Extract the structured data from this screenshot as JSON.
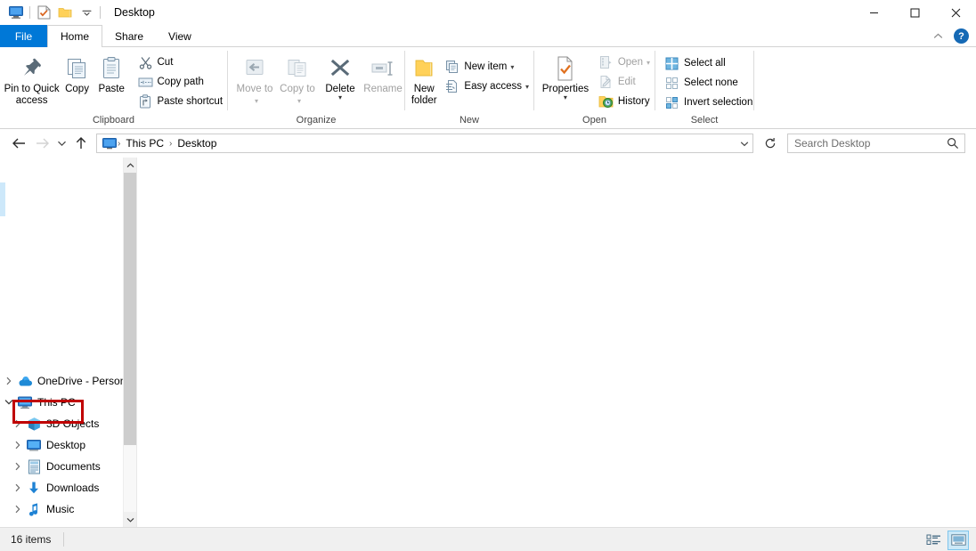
{
  "window": {
    "title": "Desktop",
    "quick_access": [
      {
        "name": "this-pc-icon",
        "label": "This PC"
      },
      {
        "name": "properties-check-icon",
        "label": "Properties"
      },
      {
        "name": "new-folder-icon",
        "label": "New folder"
      },
      {
        "name": "customize-qat-chevron-icon",
        "label": "Customize Quick Access Toolbar"
      }
    ],
    "controls": {
      "minimize": "—",
      "maximize": "□",
      "close": "✕",
      "collapse_ribbon": "⌃",
      "help": "?"
    }
  },
  "tabs": [
    {
      "label": "File",
      "active": false,
      "style": "file"
    },
    {
      "label": "Home",
      "active": true,
      "style": "normal"
    },
    {
      "label": "Share",
      "active": false,
      "style": "normal"
    },
    {
      "label": "View",
      "active": false,
      "style": "normal"
    }
  ],
  "ribbon": {
    "groups": [
      {
        "label": "Clipboard",
        "big_buttons": [
          {
            "label": "Pin to Quick access",
            "icon": "pin-icon",
            "disabled": false
          },
          {
            "label": "Copy",
            "icon": "copy-icon",
            "disabled": false
          },
          {
            "label": "Paste",
            "icon": "paste-icon",
            "disabled": false
          }
        ],
        "small_buttons": [
          {
            "label": "Cut",
            "icon": "scissors-icon",
            "disabled": false,
            "caret": false
          },
          {
            "label": "Copy path",
            "icon": "copy-path-icon",
            "disabled": false,
            "caret": false
          },
          {
            "label": "Paste shortcut",
            "icon": "paste-shortcut-icon",
            "disabled": false,
            "caret": false
          }
        ]
      },
      {
        "label": "Organize",
        "big_buttons": [
          {
            "label": "Move to",
            "icon": "move-to-icon",
            "disabled": true,
            "caret": true
          },
          {
            "label": "Copy to",
            "icon": "copy-to-icon",
            "disabled": true,
            "caret": true
          },
          {
            "label": "Delete",
            "icon": "delete-x-icon",
            "disabled": false,
            "caret": true
          },
          {
            "label": "Rename",
            "icon": "rename-icon",
            "disabled": true,
            "caret": false
          }
        ],
        "small_buttons": []
      },
      {
        "label": "New",
        "big_buttons": [
          {
            "label": "New folder",
            "icon": "new-folder-icon",
            "disabled": false
          }
        ],
        "small_buttons": [
          {
            "label": "New item",
            "icon": "new-item-icon",
            "disabled": false,
            "caret": true
          },
          {
            "label": "Easy access",
            "icon": "easy-access-icon",
            "disabled": false,
            "caret": true
          }
        ]
      },
      {
        "label": "Open",
        "big_buttons": [
          {
            "label": "Properties",
            "icon": "properties-icon",
            "disabled": false,
            "caret": true
          }
        ],
        "small_buttons": [
          {
            "label": "Open",
            "icon": "open-icon",
            "disabled": true,
            "caret": true
          },
          {
            "label": "Edit",
            "icon": "edit-icon",
            "disabled": true,
            "caret": false
          },
          {
            "label": "History",
            "icon": "history-icon",
            "disabled": false,
            "caret": false
          }
        ]
      },
      {
        "label": "Select",
        "big_buttons": [],
        "small_buttons": [
          {
            "label": "Select all",
            "icon": "select-all-icon",
            "disabled": false,
            "caret": false
          },
          {
            "label": "Select none",
            "icon": "select-none-icon",
            "disabled": false,
            "caret": false
          },
          {
            "label": "Invert selection",
            "icon": "invert-selection-icon",
            "disabled": false,
            "caret": false
          }
        ]
      }
    ]
  },
  "address_bar": {
    "back": {
      "label": "Back",
      "enabled": true
    },
    "forward": {
      "label": "Forward",
      "enabled": false
    },
    "recent": {
      "label": "Recent locations",
      "enabled": true
    },
    "up": {
      "label": "Up",
      "enabled": true
    },
    "breadcrumbs": [
      {
        "label": "This PC"
      },
      {
        "label": "Desktop"
      }
    ],
    "separator": "›",
    "dropdown": "⌄",
    "refresh": "↻"
  },
  "search": {
    "placeholder": "Search Desktop",
    "value": ""
  },
  "nav_pane": {
    "items": [
      {
        "label": "OneDrive - Personal",
        "icon": "onedrive-cloud-icon",
        "indent": 0,
        "expander": "collapsed",
        "highlighted": false
      },
      {
        "label": "This PC",
        "icon": "this-pc-icon",
        "indent": 0,
        "expander": "expanded",
        "highlighted": true
      },
      {
        "label": "3D Objects",
        "icon": "3d-objects-icon",
        "indent": 1,
        "expander": "collapsed",
        "highlighted": false
      },
      {
        "label": "Desktop",
        "icon": "desktop-icon",
        "indent": 1,
        "expander": "collapsed",
        "highlighted": false
      },
      {
        "label": "Documents",
        "icon": "documents-icon",
        "indent": 1,
        "expander": "collapsed",
        "highlighted": false
      },
      {
        "label": "Downloads",
        "icon": "downloads-icon",
        "indent": 1,
        "expander": "collapsed",
        "highlighted": false
      },
      {
        "label": "Music",
        "icon": "music-icon",
        "indent": 1,
        "expander": "collapsed",
        "highlighted": false
      }
    ],
    "scroll_up": "⌃",
    "scroll_down": "⌄"
  },
  "status_bar": {
    "item_count": "16 items",
    "views": [
      {
        "name": "details-view-button",
        "label": "Details",
        "selected": false
      },
      {
        "name": "large-icons-view-button",
        "label": "Large icons",
        "selected": true
      }
    ]
  },
  "colors": {
    "accent": "#0078d7",
    "annotation_red": "#c00000",
    "selection_blue": "#cce8f7",
    "folder_yellow": "#ffd159"
  }
}
